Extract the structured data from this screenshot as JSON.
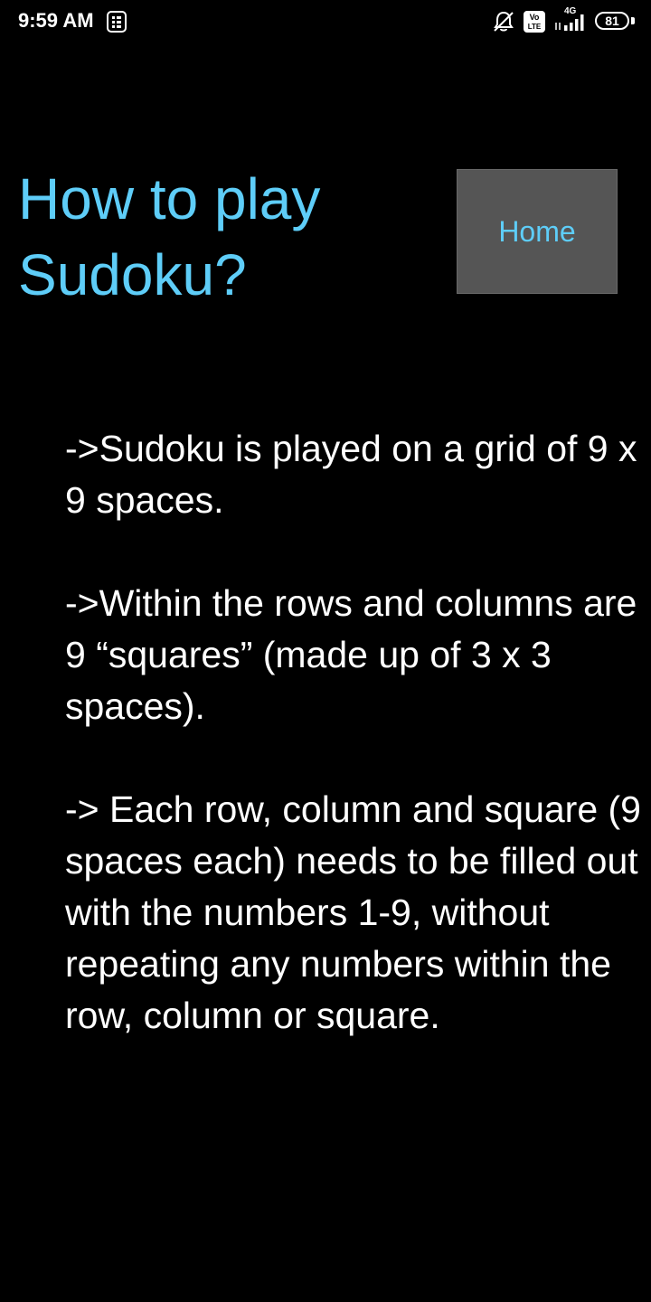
{
  "status_bar": {
    "time": "9:59 AM",
    "battery_level": "81",
    "network_label": "4G",
    "volte_label": "Vo LTE",
    "icons": [
      "app-notification-icon",
      "silent-bell-icon",
      "volte-icon",
      "signal-icon",
      "battery-icon"
    ]
  },
  "page": {
    "title": "How to play Sudoku?",
    "home_button_label": "Home"
  },
  "instructions": [
    "->Sudoku is played on a grid of 9 x 9 spaces.",
    "->Within the rows and columns are 9 “squares” (made up of 3 x 3 spaces).",
    "-> Each row, column and square (9 spaces each) needs to be filled out with the numbers 1-9, without repeating any numbers within the row, column or square."
  ],
  "colors": {
    "background": "#000000",
    "accent": "#5ecdf8",
    "button_background": "#555555",
    "text": "#ffffff"
  }
}
